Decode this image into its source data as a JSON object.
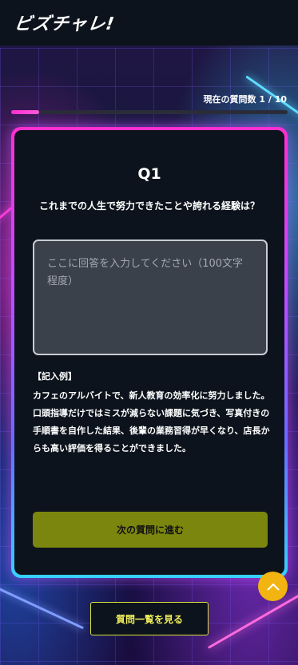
{
  "header": {
    "logo_text": "ビズチャレ!"
  },
  "progress": {
    "label": "現在の質問数 1 / 10",
    "current": 1,
    "total": 10,
    "fraction": 0.1
  },
  "question": {
    "number": "Q1",
    "text": "これまでの人生で努力できたことや誇れる経験は？"
  },
  "answer_field": {
    "placeholder": "ここに回答を入力してください（100文字程度）",
    "value": ""
  },
  "example": {
    "heading": "【記入例】",
    "body": "カフェのアルバイトで、新人教育の効率化に努力しました。口頭指導だけではミスが減らない課題に気づき、写真付きの手順書を自作した結果、後輩の業務習得が早くなり、店長からも高い評価を得ることができました。"
  },
  "buttons": {
    "next": "次の質問に進む",
    "list": "質問一覧を見る"
  },
  "icons": {
    "scroll_top": "chevron-up-icon"
  },
  "colors": {
    "accent": "#ff2fd0",
    "next_button": "#7b860f",
    "scroll_button": "#f2b411"
  }
}
